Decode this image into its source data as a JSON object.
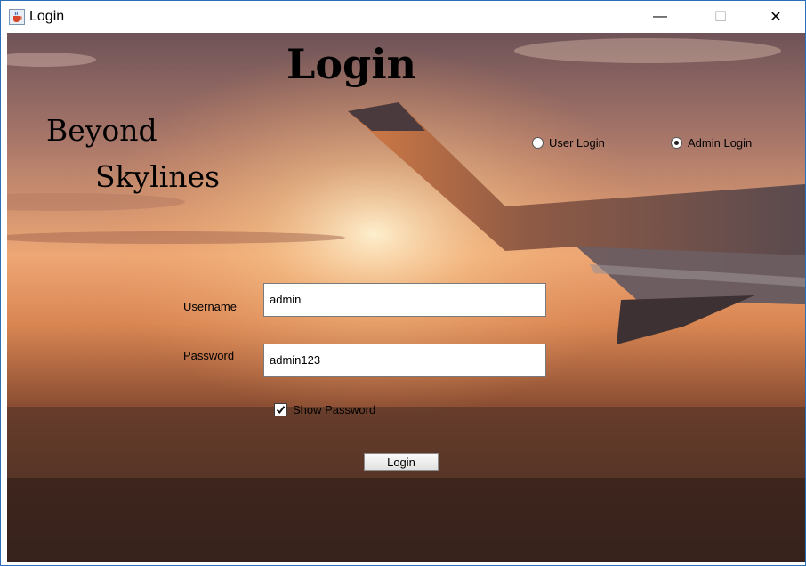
{
  "window": {
    "title": "Login",
    "icon": "java-cup-icon",
    "controls": {
      "minimize": "—",
      "maximize": "☐",
      "close": "✕"
    }
  },
  "header": {
    "heading": "Login",
    "brand_line1": "Beyond",
    "brand_line2": "Skylines"
  },
  "login_type": {
    "options": [
      {
        "label": "User Login",
        "selected": false
      },
      {
        "label": "Admin Login",
        "selected": true
      }
    ]
  },
  "form": {
    "username_label": "Username",
    "username_value": "admin",
    "password_label": "Password",
    "password_value": "admin123",
    "show_password_label": "Show Password",
    "show_password_checked": true,
    "submit_label": "Login"
  },
  "colors": {
    "sky_top": "#8a6a68",
    "sky_mid": "#e9a070",
    "sun": "#fbe1b0",
    "ground": "#3a2620",
    "window_border": "#2b6fb8"
  }
}
